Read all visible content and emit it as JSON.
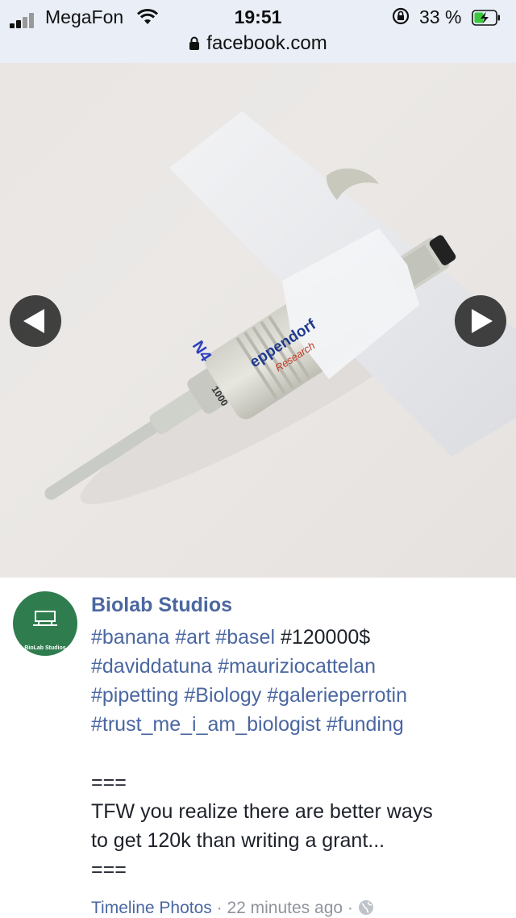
{
  "status_bar": {
    "carrier": "MegaFon",
    "time": "19:51",
    "battery_percent": "33 %",
    "url": "facebook.com"
  },
  "photo": {
    "brand_text": "eppendorf",
    "brand_subtext": "Research",
    "volume_text": "1000",
    "tape_mark": "N4"
  },
  "post": {
    "page_name": "Biolab Studios",
    "avatar_text": "BioLab Studios",
    "lines": [
      [
        {
          "text": "#banana",
          "tag": true
        },
        {
          "text": " ",
          "tag": false
        },
        {
          "text": "#art",
          "tag": true
        },
        {
          "text": " ",
          "tag": false
        },
        {
          "text": "#basel",
          "tag": true
        },
        {
          "text": " #120000$",
          "tag": false
        }
      ],
      [
        {
          "text": "#daviddatuna",
          "tag": true
        },
        {
          "text": " ",
          "tag": false
        },
        {
          "text": "#mauriziocattelan",
          "tag": true
        }
      ],
      [
        {
          "text": "#pipetting",
          "tag": true
        },
        {
          "text": " ",
          "tag": false
        },
        {
          "text": "#Biology",
          "tag": true
        },
        {
          "text": " ",
          "tag": false
        },
        {
          "text": "#galerieperrotin",
          "tag": true
        }
      ],
      [
        {
          "text": "#trust_me_i_am_biologist",
          "tag": true
        },
        {
          "text": " ",
          "tag": false
        },
        {
          "text": "#funding",
          "tag": true
        }
      ]
    ],
    "separator_top": "===",
    "body_line_1": "TFW you realize there are better ways",
    "body_line_2": "to get 120k than writing a grant...",
    "separator_bottom": "===",
    "meta_album": "Timeline Photos",
    "meta_time": " · 22 minutes ago · "
  },
  "colors": {
    "link_blue": "#4b67a1",
    "avatar_green": "#2f7d4e",
    "status_bg": "#e9eef7"
  },
  "icons": [
    "signal-icon",
    "wifi-icon",
    "rotation-lock-icon",
    "battery-charging-icon",
    "padlock-icon",
    "chevron-left-icon",
    "chevron-right-icon",
    "globe-icon"
  ]
}
